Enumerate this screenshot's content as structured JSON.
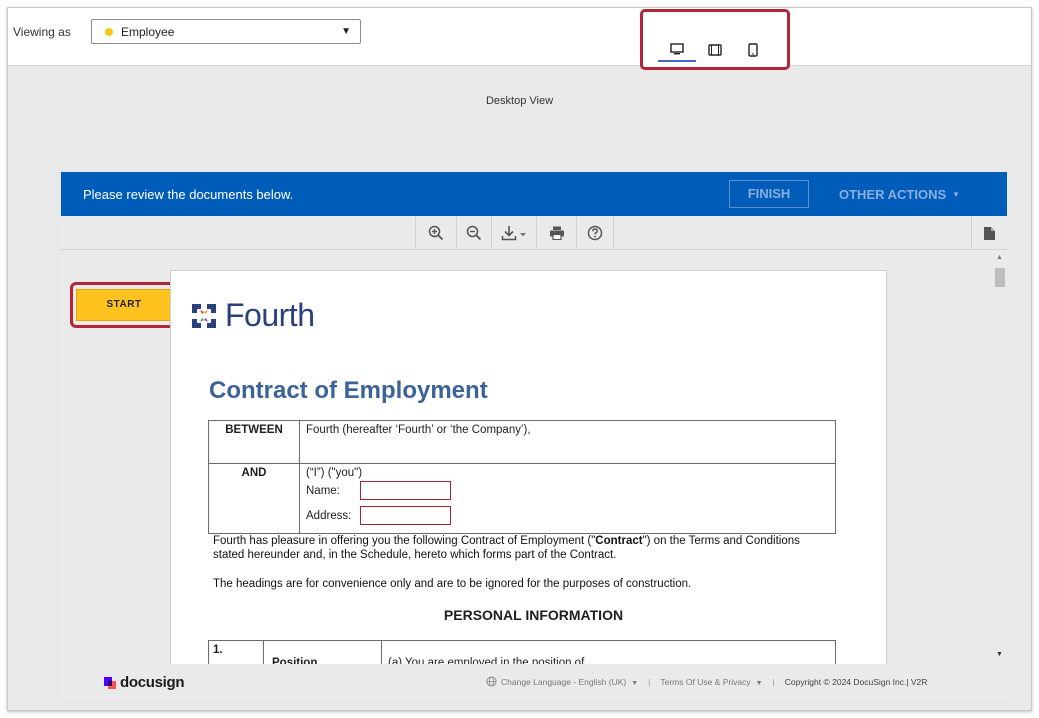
{
  "header": {
    "viewing_label": "Viewing as",
    "viewing_value": "Employee",
    "viewing_arrow": "▼"
  },
  "device_icons": [
    "desktop-icon",
    "tablet-icon",
    "phone-icon"
  ],
  "desktop_view_label": "Desktop View",
  "banner": {
    "message": "Please review the documents below.",
    "finish_label": "FINISH",
    "other_actions_label": "OTHER ACTIONS",
    "other_actions_arrow": "▼"
  },
  "toolbar_icons": [
    "zoom-in-icon",
    "zoom-out-icon",
    "download-icon",
    "print-icon",
    "help-icon",
    "page-icon"
  ],
  "start_label": "START",
  "document": {
    "logo_text": "Fourth",
    "title": "Contract of Employment",
    "between_label": "BETWEEN",
    "between_text": "Fourth (hereafter ‘Fourth’ or ‘the Company’),",
    "and_label": "AND",
    "and_text": "(“I”) (\"you\")",
    "name_label": "Name:",
    "address_label": "Address:",
    "intro_part1": "Fourth has pleasure in offering you the following Contract of Employment (\"",
    "intro_bold": "Contract",
    "intro_part2": "\") on the Terms and Conditions stated hereunder and, in the Schedule, hereto which forms part of the Contract.",
    "headings_note": "The headings are for convenience only and are to be ignored for the purposes of construction.",
    "section_heading": "PERSONAL INFORMATION",
    "info_number": "1.",
    "info_label": "Position",
    "info_text": "(a)  You are employed in the position of"
  },
  "footer": {
    "brand": "docusign",
    "change_language": "Change Language - English (UK)",
    "terms": "Terms Of Use & Privacy",
    "copyright": "Copyright © 2024 DocuSign Inc.| V2R",
    "dropdown_arrow": "▼"
  },
  "colors": {
    "brand_blue": "#005cb9",
    "start_yellow": "#ffc21e",
    "highlight_red": "#b3263a",
    "title_blue": "#3b6398"
  }
}
